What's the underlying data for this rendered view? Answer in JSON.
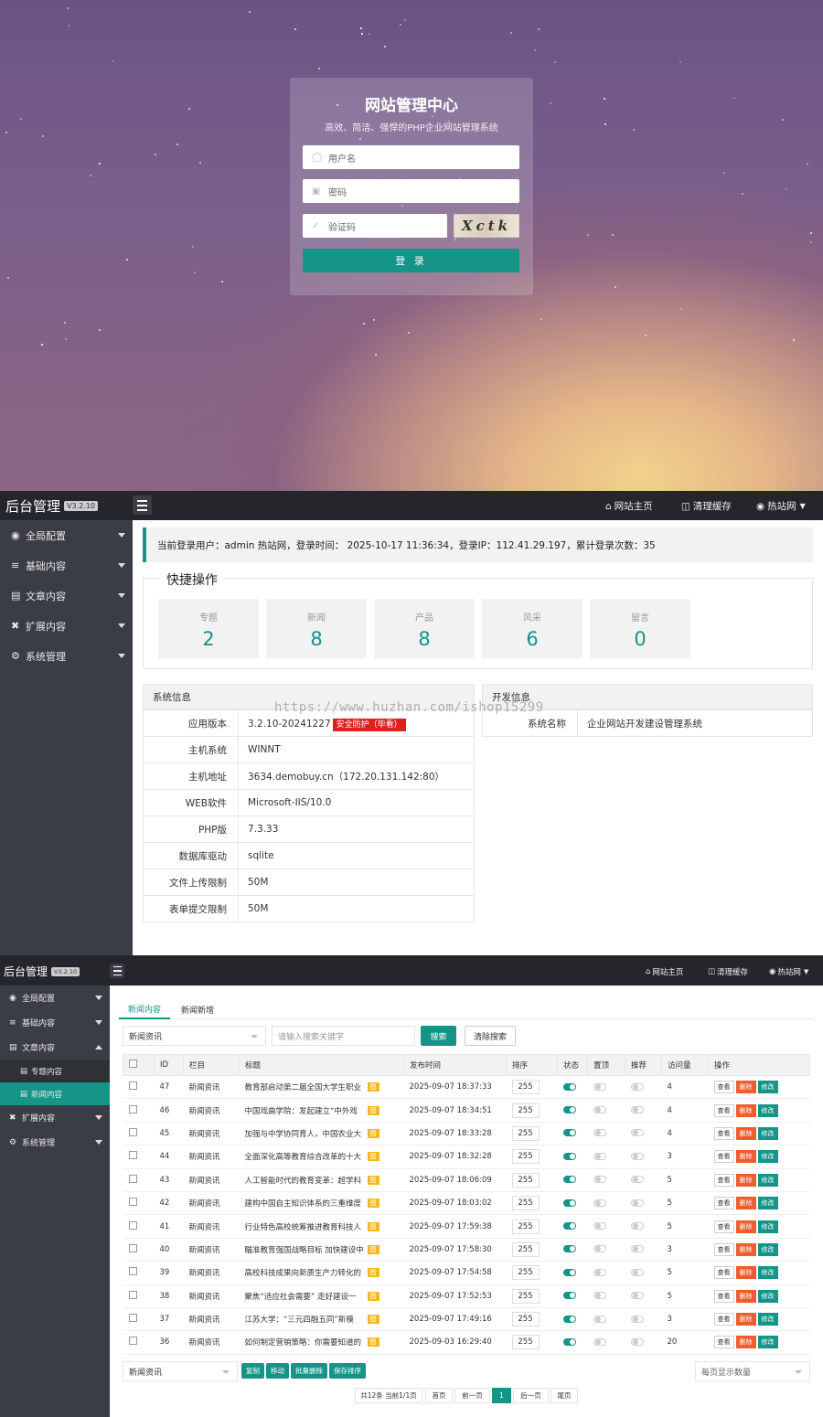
{
  "login": {
    "title": "网站管理中心",
    "subtitle": "高效、简洁、强悍的PHP企业网站管理系统",
    "username_placeholder": "用户名",
    "password_placeholder": "密码",
    "captcha_placeholder": "验证码",
    "captcha_text": "Xctk",
    "submit_label": "登 录"
  },
  "admin1": {
    "brand": "后台管理",
    "version": "V3.2.10",
    "nav": {
      "home": "网站主页",
      "clear_cache": "清理缓存",
      "user": "热站网"
    },
    "sidebar": [
      "全局配置",
      "基础内容",
      "文章内容",
      "扩展内容",
      "系统管理"
    ],
    "welcome": "当前登录用户：admin 热站网，登录时间： 2025-10-17 11:36:34，登录IP：112.41.29.197，累计登录次数：35",
    "quick_title": "快捷操作",
    "quick": [
      {
        "label": "专题",
        "value": "2"
      },
      {
        "label": "新闻",
        "value": "8"
      },
      {
        "label": "产品",
        "value": "8"
      },
      {
        "label": "风采",
        "value": "6"
      },
      {
        "label": "留言",
        "value": "0"
      }
    ],
    "sysinfo_title": "系统信息",
    "sysinfo": [
      {
        "k": "应用版本",
        "v": "3.2.10-20241227"
      },
      {
        "k": "主机系统",
        "v": "WINNT"
      },
      {
        "k": "主机地址",
        "v": "3634.demobuy.cn（172.20.131.142:80）"
      },
      {
        "k": "WEB软件",
        "v": "Microsoft-IIS/10.0"
      },
      {
        "k": "PHP版",
        "v": "7.3.33"
      },
      {
        "k": "数据库驱动",
        "v": "sqlite"
      },
      {
        "k": "文件上传限制",
        "v": "50M"
      },
      {
        "k": "表单提交限制",
        "v": "50M"
      }
    ],
    "security_tag": "安全防护（毕看）",
    "devinfo_title": "开发信息",
    "devinfo": {
      "k": "系统名称",
      "v": "企业网站开发建设管理系统"
    },
    "watermark": "https://www.huzhan.com/ishop15299"
  },
  "admin2": {
    "brand": "后台管理",
    "version": "V3.2.10",
    "nav": {
      "home": "网站主页",
      "clear_cache": "清理缓存",
      "user": "热站网"
    },
    "sidebar": {
      "items": [
        "全局配置",
        "基础内容",
        "文章内容"
      ],
      "subs": [
        "专题内容",
        "新闻内容"
      ],
      "items2": [
        "扩展内容",
        "系统管理"
      ]
    },
    "tabs": [
      "新闻内容",
      "新闻新增"
    ],
    "filter_select": "新闻资讯",
    "search_placeholder": "请输入搜索关键字",
    "search_btn": "搜索",
    "clear_btn": "清除搜索",
    "columns": [
      "ID",
      "栏目",
      "标题",
      "发布时间",
      "排序",
      "状态",
      "置顶",
      "推荐",
      "访问量",
      "操作"
    ],
    "rows": [
      {
        "id": "47",
        "cat": "新闻资讯",
        "title": "教育部启动第二届全国大学生职业",
        "time": "2025-09-07 18:37:33",
        "sort": "255",
        "views": "4"
      },
      {
        "id": "46",
        "cat": "新闻资讯",
        "title": "中国戏曲学院：发起建立“中外戏",
        "time": "2025-09-07 18:34:51",
        "sort": "255",
        "views": "4"
      },
      {
        "id": "45",
        "cat": "新闻资讯",
        "title": "加强与中学协同育人，中国农业大",
        "time": "2025-09-07 18:33:28",
        "sort": "255",
        "views": "4"
      },
      {
        "id": "44",
        "cat": "新闻资讯",
        "title": "全面深化高等教育综合改革的十大",
        "time": "2025-09-07 18:32:28",
        "sort": "255",
        "views": "3"
      },
      {
        "id": "43",
        "cat": "新闻资讯",
        "title": "人工智能时代的教育变革：超学科",
        "time": "2025-09-07 18:06:09",
        "sort": "255",
        "views": "5"
      },
      {
        "id": "42",
        "cat": "新闻资讯",
        "title": "建构中国自主知识体系的三重维度",
        "time": "2025-09-07 18:03:02",
        "sort": "255",
        "views": "5"
      },
      {
        "id": "41",
        "cat": "新闻资讯",
        "title": "行业特色高校统筹推进教育科技人",
        "time": "2025-09-07 17:59:38",
        "sort": "255",
        "views": "5"
      },
      {
        "id": "40",
        "cat": "新闻资讯",
        "title": "瞄准教育强国战略目标 加快建设中",
        "time": "2025-09-07 17:58:30",
        "sort": "255",
        "views": "3"
      },
      {
        "id": "39",
        "cat": "新闻资讯",
        "title": "高校科技成果向新质生产力转化的",
        "time": "2025-09-07 17:54:58",
        "sort": "255",
        "views": "5"
      },
      {
        "id": "38",
        "cat": "新闻资讯",
        "title": "聚焦“适应社会需要” 走好建设一",
        "time": "2025-09-07 17:52:53",
        "sort": "255",
        "views": "5"
      },
      {
        "id": "37",
        "cat": "新闻资讯",
        "title": "江苏大学：“三元四融五同”新模",
        "time": "2025-09-07 17:49:16",
        "sort": "255",
        "views": "3"
      },
      {
        "id": "36",
        "cat": "新闻资讯",
        "title": "如何制定营销策略：你需要知道的",
        "time": "2025-09-03 16:29:40",
        "sort": "255",
        "views": "20"
      }
    ],
    "badge": "图",
    "ops": {
      "view": "查看",
      "del": "删除",
      "edit": "修改"
    },
    "bottom_select": "新闻资讯",
    "batch": [
      "复制",
      "移动",
      "批量删除",
      "保存排序"
    ],
    "per_page": "每页显示数量",
    "pager": {
      "info": "共12条 当前1/1页",
      "first": "首页",
      "prev": "前一页",
      "cur": "1",
      "next": "后一页",
      "last": "尾页"
    }
  }
}
